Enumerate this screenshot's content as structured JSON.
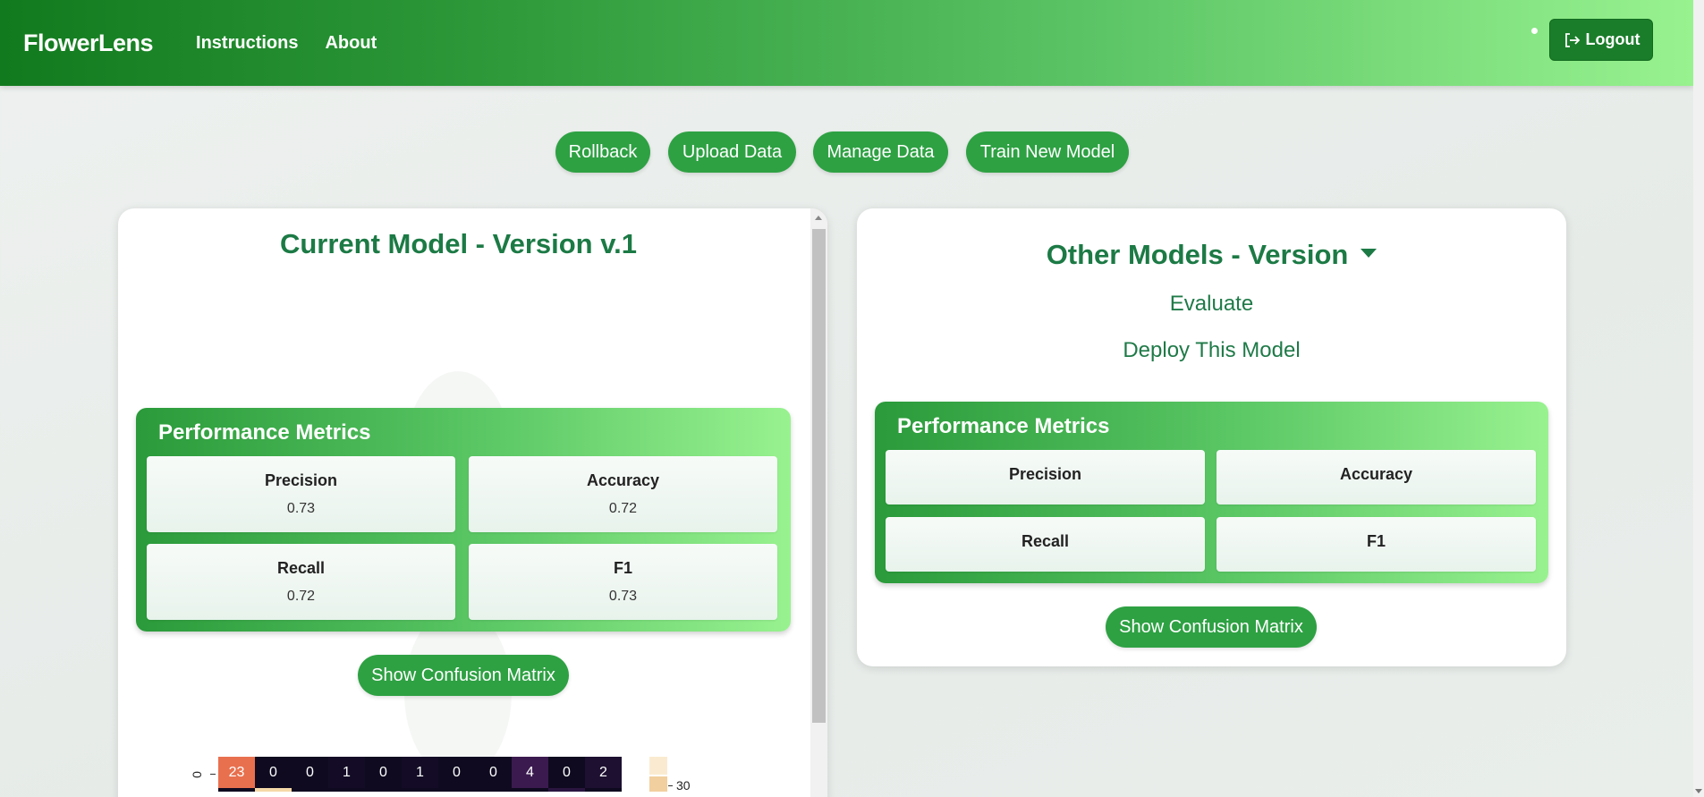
{
  "navbar": {
    "brand": "FlowerLens",
    "links": [
      "Instructions",
      "About"
    ],
    "logout_label": "Logout"
  },
  "actions": [
    "Rollback",
    "Upload Data",
    "Manage Data",
    "Train New Model"
  ],
  "current_model": {
    "title": "Current Model - Version v.1",
    "metrics_heading": "Performance Metrics",
    "metrics": [
      {
        "label": "Precision",
        "value": "0.73"
      },
      {
        "label": "Accuracy",
        "value": "0.72"
      },
      {
        "label": "Recall",
        "value": "0.72"
      },
      {
        "label": "F1",
        "value": "0.73"
      }
    ],
    "show_cm_label": "Show Confusion Matrix",
    "confusion_matrix": {
      "row_label": "0",
      "first_row": [
        "23",
        "0",
        "0",
        "1",
        "0",
        "1",
        "0",
        "0",
        "4",
        "0",
        "2"
      ],
      "colorbar_tick": "30"
    }
  },
  "other_models": {
    "title": "Other Models - Version",
    "evaluate_label": "Evaluate",
    "deploy_label": "Deploy This Model",
    "metrics_heading": "Performance Metrics",
    "metrics": [
      {
        "label": "Precision"
      },
      {
        "label": "Accuracy"
      },
      {
        "label": "Recall"
      },
      {
        "label": "F1"
      }
    ],
    "show_cm_label": "Show Confusion Matrix"
  },
  "colors": {
    "primary": "#2ea143",
    "title_green": "#1c7a45",
    "nav_dark": "#127a1e",
    "nav_light": "#98f28f"
  }
}
